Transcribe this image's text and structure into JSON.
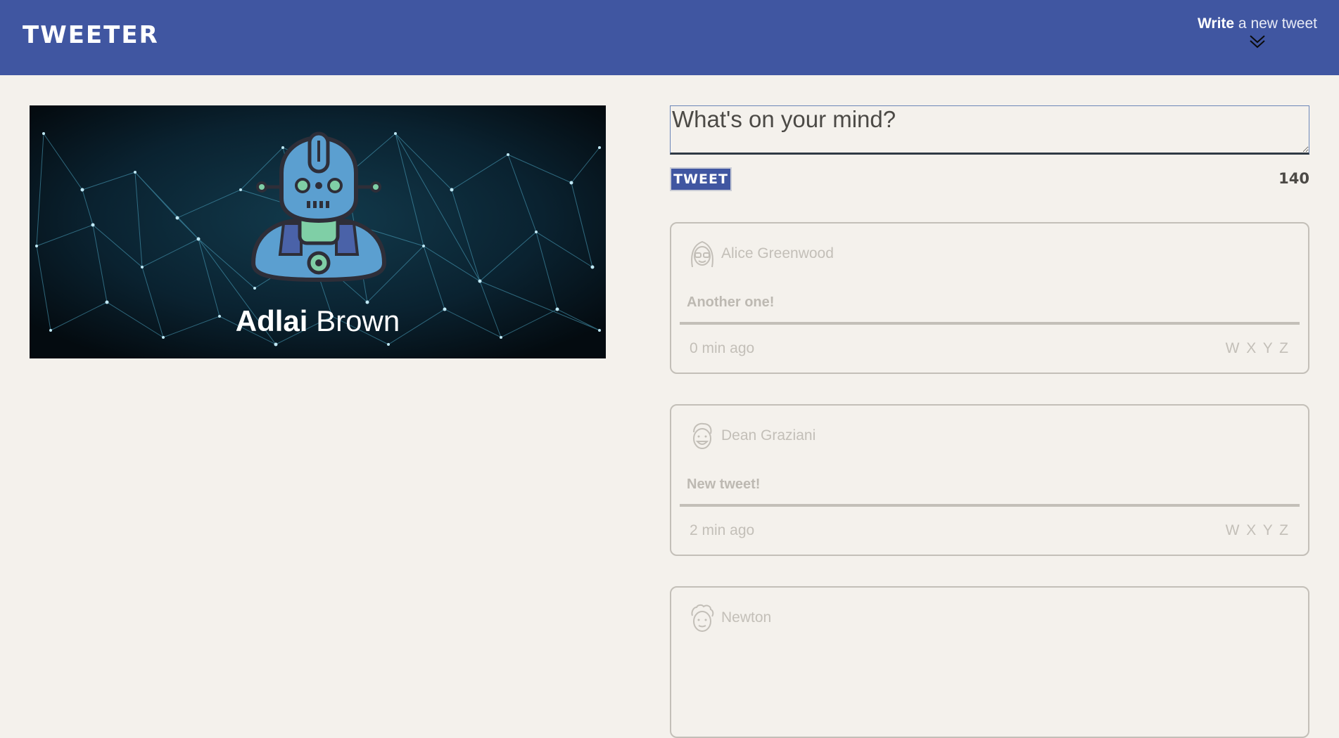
{
  "header": {
    "brand": "TWEETER",
    "compose_bold": "Write",
    "compose_rest": " a new tweet",
    "compose_icon": "double-chevron-down-icon",
    "color": "#4056a1"
  },
  "profile": {
    "first_name": "Adlai",
    "last_name": "Brown",
    "avatar_icon": "robot-avatar-icon"
  },
  "compose": {
    "placeholder": "What's on your mind?",
    "button_label": "TWEET",
    "counter": "140"
  },
  "tweets": [
    {
      "author": "Alice Greenwood",
      "avatar_icon": "girl-with-glasses-avatar-icon",
      "content": "Another one!",
      "time": "0 min ago",
      "actions": "W X Y Z"
    },
    {
      "author": "Dean Graziani",
      "avatar_icon": "smiling-man-avatar-icon",
      "content": "New tweet!",
      "time": "2 min ago",
      "actions": "W X Y Z"
    },
    {
      "author": "Newton",
      "avatar_icon": "curly-hair-man-avatar-icon"
    }
  ]
}
